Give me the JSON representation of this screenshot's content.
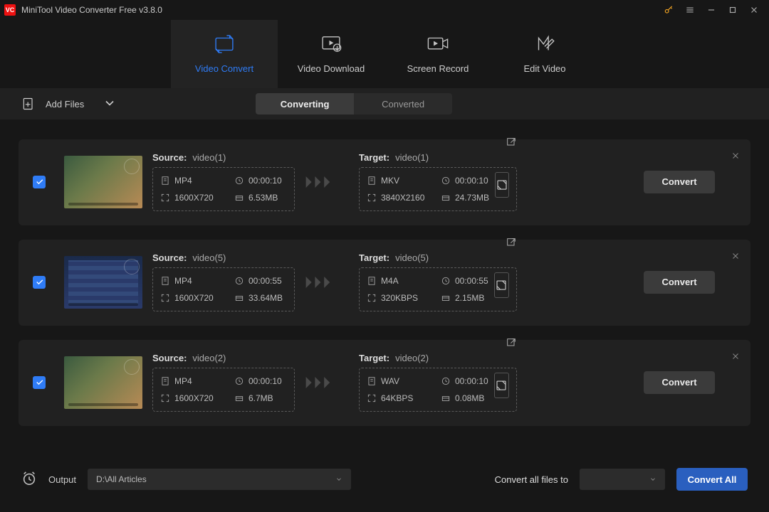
{
  "window": {
    "title": "MiniTool Video Converter Free v3.8.0"
  },
  "tabs": {
    "convert": "Video Convert",
    "download": "Video Download",
    "record": "Screen Record",
    "edit": "Edit Video"
  },
  "toolbar": {
    "add_files": "Add Files",
    "seg_converting": "Converting",
    "seg_converted": "Converted"
  },
  "labels": {
    "source": "Source:",
    "target": "Target:",
    "convert": "Convert"
  },
  "items": [
    {
      "source_name": "video(1)",
      "source": {
        "format": "MP4",
        "duration": "00:00:10",
        "resolution": "1600X720",
        "size": "6.53MB"
      },
      "target_name": "video(1)",
      "target": {
        "format": "MKV",
        "duration": "00:00:10",
        "resolution": "3840X2160",
        "size": "24.73MB"
      },
      "thumb_class": "game1"
    },
    {
      "source_name": "video(5)",
      "source": {
        "format": "MP4",
        "duration": "00:00:55",
        "resolution": "1600X720",
        "size": "33.64MB"
      },
      "target_name": "video(5)",
      "target": {
        "format": "M4A",
        "duration": "00:00:55",
        "resolution": "320KBPS",
        "size": "2.15MB"
      },
      "thumb_class": "game2"
    },
    {
      "source_name": "video(2)",
      "source": {
        "format": "MP4",
        "duration": "00:00:10",
        "resolution": "1600X720",
        "size": "6.7MB"
      },
      "target_name": "video(2)",
      "target": {
        "format": "WAV",
        "duration": "00:00:10",
        "resolution": "64KBPS",
        "size": "0.08MB"
      },
      "thumb_class": "game1"
    }
  ],
  "footer": {
    "output_label": "Output",
    "output_path": "D:\\All Articles",
    "convert_all_files_to": "Convert all files to",
    "target_format": "",
    "convert_all": "Convert All"
  }
}
